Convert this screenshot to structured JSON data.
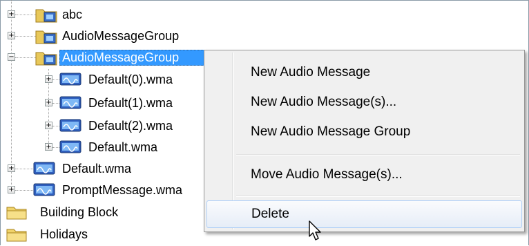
{
  "tree": {
    "nodes": [
      {
        "label": "abc"
      },
      {
        "label": "AudioMessageGroup"
      },
      {
        "label": "AudioMessageGroup"
      },
      {
        "label": "Default(0).wma"
      },
      {
        "label": "Default(1).wma"
      },
      {
        "label": "Default(2).wma"
      },
      {
        "label": "Default.wma"
      },
      {
        "label": "Default.wma"
      },
      {
        "label": "PromptMessage.wma"
      },
      {
        "label": "Building Block"
      },
      {
        "label": "Holidays"
      }
    ],
    "expander_collapsed": "+",
    "expander_expanded": "−"
  },
  "context_menu": {
    "items": [
      {
        "label": "New Audio Message"
      },
      {
        "label": "New Audio Message(s)..."
      },
      {
        "label": "New Audio Message Group"
      },
      {
        "label": "Move Audio Message(s)..."
      },
      {
        "label": "Delete"
      }
    ]
  },
  "colors": {
    "selection": "#3399ff",
    "menu_background": "#f0f0f0",
    "menu_hover_border": "#aecff7"
  }
}
